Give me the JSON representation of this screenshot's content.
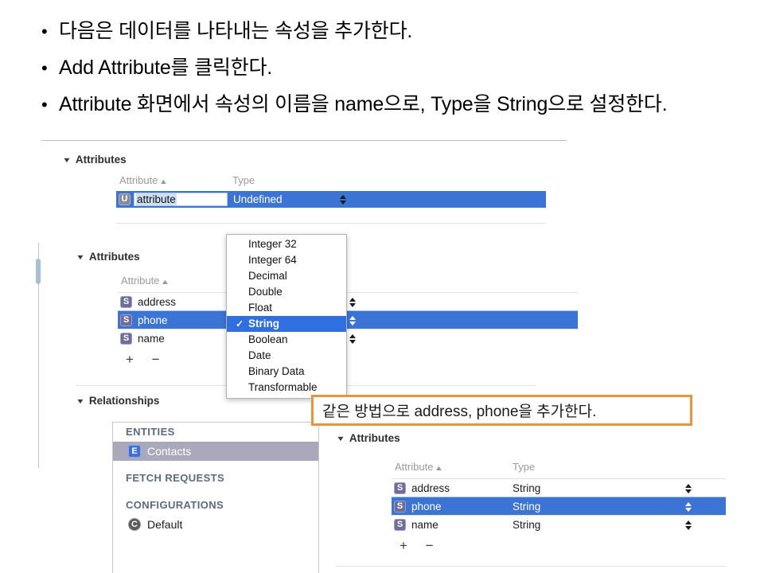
{
  "slide": {
    "bullet_marker": "•",
    "bullets": [
      "다음은 데이터를 나타내는 속성을 추가한다.",
      "Add Attribute를 클릭한다.",
      "Attribute  화면에서 속성의 이름을 name으로, Type을 String으로 설정한다."
    ]
  },
  "panel1": {
    "section_title": "Attributes",
    "disclosure": "▼",
    "col_attribute": "Attribute",
    "col_type": "Type",
    "sort_caret": "▲",
    "row": {
      "badge": "U",
      "name": "attribute",
      "type": "Undefined"
    }
  },
  "panel2": {
    "section_title": "Attributes",
    "relationships_title": "Relationships",
    "disclosure": "▼",
    "col_attribute": "Attribute",
    "sort_caret": "▲",
    "plus_minus": "+ −",
    "rows": [
      {
        "badge": "S",
        "name": "address",
        "selected": false
      },
      {
        "badge": "S",
        "name": "phone",
        "selected": true
      },
      {
        "badge": "S",
        "name": "name",
        "selected": false
      }
    ]
  },
  "type_menu": {
    "checkmark": "✓",
    "items": [
      {
        "label": "Integer 32",
        "selected": false
      },
      {
        "label": "Integer 64",
        "selected": false
      },
      {
        "label": "Decimal",
        "selected": false
      },
      {
        "label": "Double",
        "selected": false
      },
      {
        "label": "Float",
        "selected": false
      },
      {
        "label": "String",
        "selected": true
      },
      {
        "label": "Boolean",
        "selected": false
      },
      {
        "label": "Date",
        "selected": false
      },
      {
        "label": "Binary Data",
        "selected": false
      },
      {
        "label": "Transformable",
        "selected": false
      }
    ]
  },
  "callout": {
    "text": "같은 방법으로 address, phone을 추가한다.",
    "border_color": "#e8953a"
  },
  "entities_navigator": {
    "headings": {
      "entities": "ENTITIES",
      "fetch_requests": "FETCH REQUESTS",
      "configurations": "CONFIGURATIONS"
    },
    "entity": {
      "badge": "E",
      "label": "Contacts",
      "selected": true
    },
    "configuration": {
      "badge": "C",
      "label": "Default",
      "selected": false
    }
  },
  "panel3": {
    "section_title": "Attributes",
    "disclosure": "▼",
    "col_attribute": "Attribute",
    "col_type": "Type",
    "sort_caret": "▲",
    "plus_minus": "+ −",
    "rows": [
      {
        "badge": "S",
        "name": "address",
        "type": "String",
        "selected": false
      },
      {
        "badge": "S",
        "name": "phone",
        "type": "String",
        "selected": true
      },
      {
        "badge": "S",
        "name": "name",
        "type": "String",
        "selected": false
      }
    ]
  },
  "colors": {
    "selection_blue": "#3b74d4",
    "menu_selection_blue": "#2f6fe0",
    "badge_purple": "#6d6d9b",
    "callout_orange": "#e8953a",
    "nav_inactive_selection": "#a9a9bb"
  }
}
